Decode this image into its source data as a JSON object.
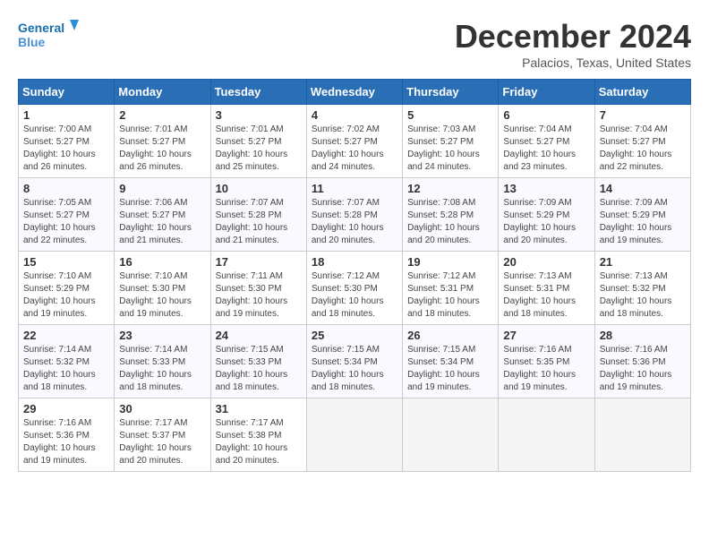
{
  "logo": {
    "line1": "General",
    "line2": "Blue"
  },
  "title": "December 2024",
  "location": "Palacios, Texas, United States",
  "days_of_week": [
    "Sunday",
    "Monday",
    "Tuesday",
    "Wednesday",
    "Thursday",
    "Friday",
    "Saturday"
  ],
  "weeks": [
    [
      {
        "day": 1,
        "info": "Sunrise: 7:00 AM\nSunset: 5:27 PM\nDaylight: 10 hours\nand 26 minutes."
      },
      {
        "day": 2,
        "info": "Sunrise: 7:01 AM\nSunset: 5:27 PM\nDaylight: 10 hours\nand 26 minutes."
      },
      {
        "day": 3,
        "info": "Sunrise: 7:01 AM\nSunset: 5:27 PM\nDaylight: 10 hours\nand 25 minutes."
      },
      {
        "day": 4,
        "info": "Sunrise: 7:02 AM\nSunset: 5:27 PM\nDaylight: 10 hours\nand 24 minutes."
      },
      {
        "day": 5,
        "info": "Sunrise: 7:03 AM\nSunset: 5:27 PM\nDaylight: 10 hours\nand 24 minutes."
      },
      {
        "day": 6,
        "info": "Sunrise: 7:04 AM\nSunset: 5:27 PM\nDaylight: 10 hours\nand 23 minutes."
      },
      {
        "day": 7,
        "info": "Sunrise: 7:04 AM\nSunset: 5:27 PM\nDaylight: 10 hours\nand 22 minutes."
      }
    ],
    [
      {
        "day": 8,
        "info": "Sunrise: 7:05 AM\nSunset: 5:27 PM\nDaylight: 10 hours\nand 22 minutes."
      },
      {
        "day": 9,
        "info": "Sunrise: 7:06 AM\nSunset: 5:27 PM\nDaylight: 10 hours\nand 21 minutes."
      },
      {
        "day": 10,
        "info": "Sunrise: 7:07 AM\nSunset: 5:28 PM\nDaylight: 10 hours\nand 21 minutes."
      },
      {
        "day": 11,
        "info": "Sunrise: 7:07 AM\nSunset: 5:28 PM\nDaylight: 10 hours\nand 20 minutes."
      },
      {
        "day": 12,
        "info": "Sunrise: 7:08 AM\nSunset: 5:28 PM\nDaylight: 10 hours\nand 20 minutes."
      },
      {
        "day": 13,
        "info": "Sunrise: 7:09 AM\nSunset: 5:29 PM\nDaylight: 10 hours\nand 20 minutes."
      },
      {
        "day": 14,
        "info": "Sunrise: 7:09 AM\nSunset: 5:29 PM\nDaylight: 10 hours\nand 19 minutes."
      }
    ],
    [
      {
        "day": 15,
        "info": "Sunrise: 7:10 AM\nSunset: 5:29 PM\nDaylight: 10 hours\nand 19 minutes."
      },
      {
        "day": 16,
        "info": "Sunrise: 7:10 AM\nSunset: 5:30 PM\nDaylight: 10 hours\nand 19 minutes."
      },
      {
        "day": 17,
        "info": "Sunrise: 7:11 AM\nSunset: 5:30 PM\nDaylight: 10 hours\nand 19 minutes."
      },
      {
        "day": 18,
        "info": "Sunrise: 7:12 AM\nSunset: 5:30 PM\nDaylight: 10 hours\nand 18 minutes."
      },
      {
        "day": 19,
        "info": "Sunrise: 7:12 AM\nSunset: 5:31 PM\nDaylight: 10 hours\nand 18 minutes."
      },
      {
        "day": 20,
        "info": "Sunrise: 7:13 AM\nSunset: 5:31 PM\nDaylight: 10 hours\nand 18 minutes."
      },
      {
        "day": 21,
        "info": "Sunrise: 7:13 AM\nSunset: 5:32 PM\nDaylight: 10 hours\nand 18 minutes."
      }
    ],
    [
      {
        "day": 22,
        "info": "Sunrise: 7:14 AM\nSunset: 5:32 PM\nDaylight: 10 hours\nand 18 minutes."
      },
      {
        "day": 23,
        "info": "Sunrise: 7:14 AM\nSunset: 5:33 PM\nDaylight: 10 hours\nand 18 minutes."
      },
      {
        "day": 24,
        "info": "Sunrise: 7:15 AM\nSunset: 5:33 PM\nDaylight: 10 hours\nand 18 minutes."
      },
      {
        "day": 25,
        "info": "Sunrise: 7:15 AM\nSunset: 5:34 PM\nDaylight: 10 hours\nand 18 minutes."
      },
      {
        "day": 26,
        "info": "Sunrise: 7:15 AM\nSunset: 5:34 PM\nDaylight: 10 hours\nand 19 minutes."
      },
      {
        "day": 27,
        "info": "Sunrise: 7:16 AM\nSunset: 5:35 PM\nDaylight: 10 hours\nand 19 minutes."
      },
      {
        "day": 28,
        "info": "Sunrise: 7:16 AM\nSunset: 5:36 PM\nDaylight: 10 hours\nand 19 minutes."
      }
    ],
    [
      {
        "day": 29,
        "info": "Sunrise: 7:16 AM\nSunset: 5:36 PM\nDaylight: 10 hours\nand 19 minutes."
      },
      {
        "day": 30,
        "info": "Sunrise: 7:17 AM\nSunset: 5:37 PM\nDaylight: 10 hours\nand 20 minutes."
      },
      {
        "day": 31,
        "info": "Sunrise: 7:17 AM\nSunset: 5:38 PM\nDaylight: 10 hours\nand 20 minutes."
      },
      null,
      null,
      null,
      null
    ]
  ]
}
